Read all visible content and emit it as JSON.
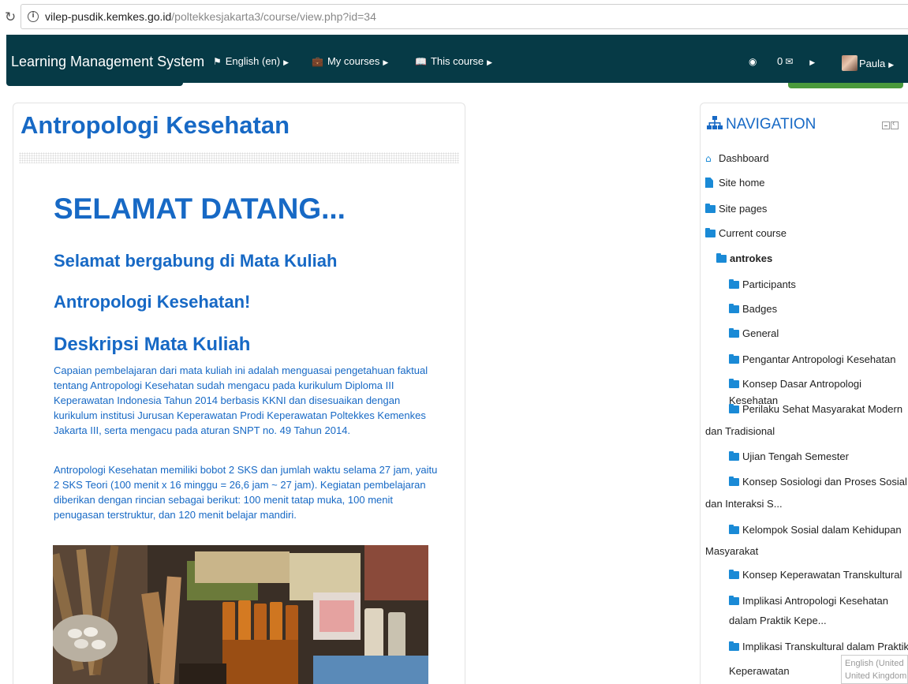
{
  "browser": {
    "url_host": "vilep-pusdik.kemkes.go.id",
    "url_path": "/poltekkesjakarta3/course/view.php?id=34"
  },
  "navbar": {
    "brand": "Learning Management System",
    "language": "English (en)",
    "my_courses": "My courses",
    "this_course": "This course",
    "messages_count": "0",
    "user_name": "Paula"
  },
  "main": {
    "course_title": "Antropologi Kesehatan",
    "welcome": "SELAMAT DATANG...",
    "subtitle_1": "Selamat bergabung di Mata Kuliah",
    "subtitle_2": "Antropologi Kesehatan!",
    "desc_heading": "Deskripsi Mata Kuliah",
    "paragraph_1": "Capaian pembelajaran dari mata kuliah ini adalah menguasai pengetahuan faktual tentang Antropologi Kesehatan sudah mengacu pada kurikulum Diploma III Keperawatan Indonesia Tahun 2014 berbasis KKNI dan disesuaikan dengan kurikulum institusi Jurusan Keperawatan Prodi Keperawatan Poltekkes Kemenkes Jakarta III, serta mengacu pada aturan SNPT no. 49 Tahun 2014.",
    "paragraph_2": " Antropologi Kesehatan memiliki bobot 2 SKS dan jumlah waktu selama 27 jam, yaitu 2 SKS Teori (100 menit x 16 minggu = 26,6 jam ~ 27 jam). Kegiatan pembelajaran diberikan dengan rincian sebagai berikut: 100 menit tatap muka, 100 menit penugasan terstruktur, dan 120 menit belajar mandiri."
  },
  "navigation": {
    "title": "NAVIGATION",
    "dashboard": "Dashboard",
    "site_home": "Site home",
    "site_pages": "Site pages",
    "current_course": "Current course",
    "course_short": "antrokes",
    "sections": [
      "Participants",
      "Badges",
      "General",
      "Pengantar Antropologi Kesehatan",
      "Konsep Dasar Antropologi Kesehatan",
      "Perilaku Sehat Masyarakat Modern",
      "dan Tradisional",
      "Ujian Tengah Semester",
      "Konsep Sosiologi dan Proses Sosial",
      "dan Interaksi S...",
      "Kelompok Sosial dalam Kehidupan",
      "Masyarakat",
      "Konsep Keperawatan Transkultural",
      "Implikasi Antropologi Kesehatan",
      "dalam Praktik Kepe...",
      "Implikasi Transkultural dalam Praktik",
      "Keperawatan"
    ]
  },
  "tooltip": {
    "line1": "English (United",
    "line2": "United Kingdom"
  }
}
